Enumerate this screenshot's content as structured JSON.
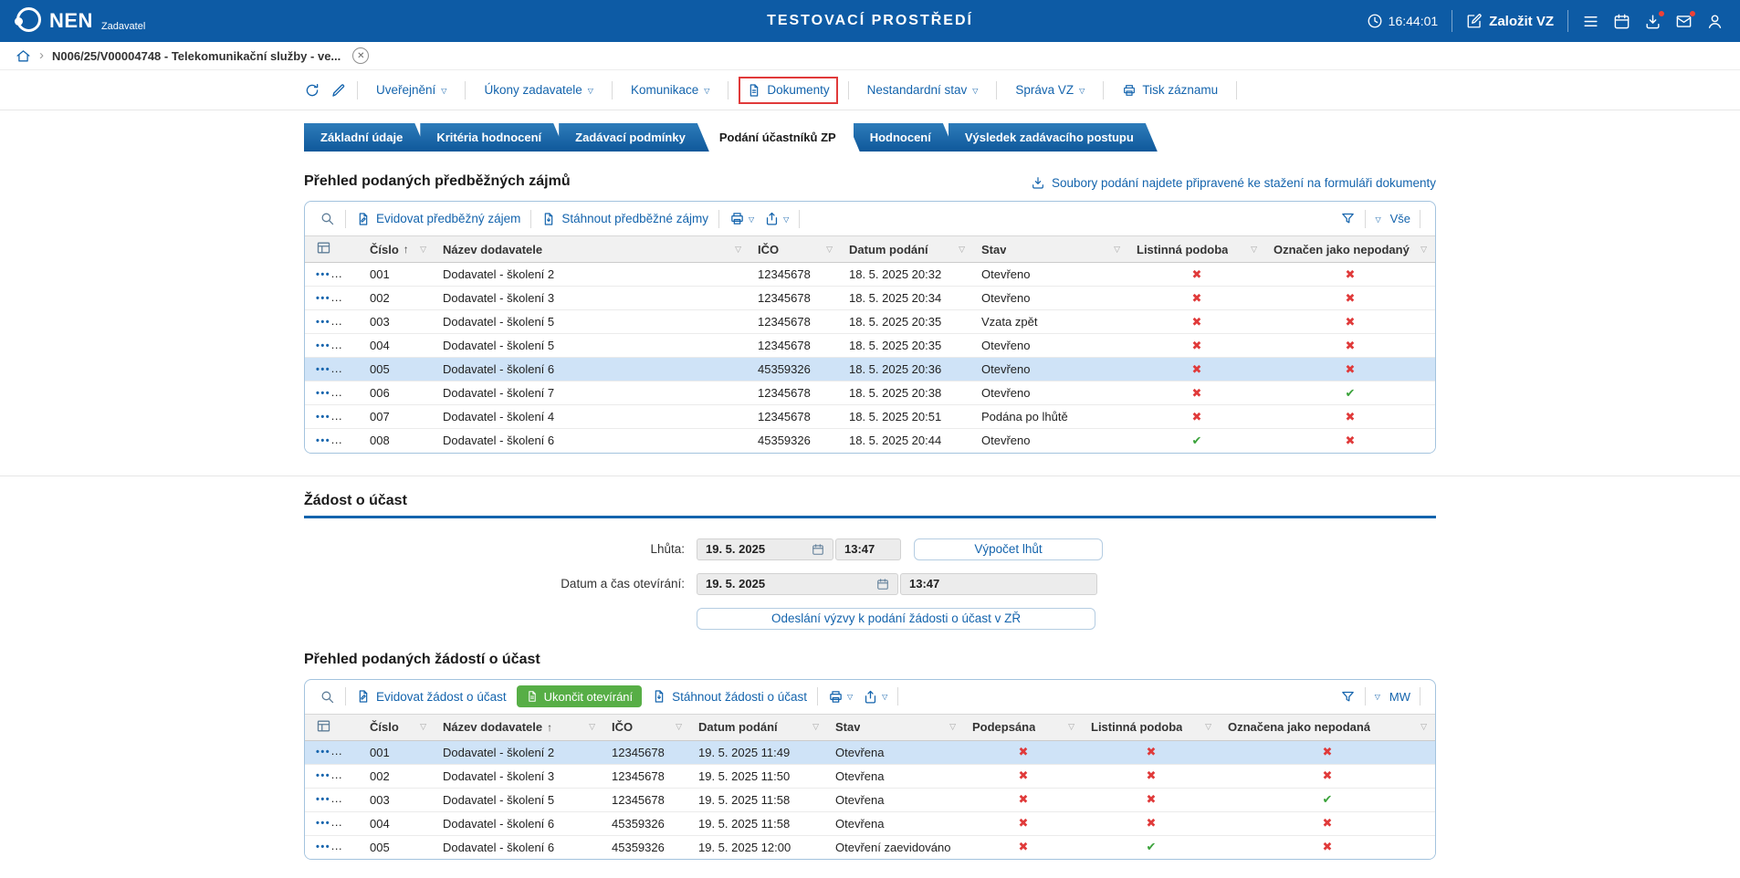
{
  "colors": {
    "topbar_blue": "#0d5ba5",
    "accent_blue": "#1464ad",
    "tab_blue_top": "#2e7cba",
    "tab_blue_bottom": "#0f589b",
    "green_button": "#57ae46",
    "check_green": "#3aa23a",
    "cross_red": "#e03a3a",
    "selected_row": "#cfe3f7",
    "highlight_box_red": "#e03a3a"
  },
  "icons": {
    "dots": "•••",
    "info": "i",
    "check": "✔",
    "cross": "✖",
    "dropdown": "▽",
    "filter": "▽",
    "sort_asc": "↑",
    "chevron": "›",
    "close": "✕"
  },
  "topbar": {
    "brand": "NEN",
    "brand_sub": "Zadavatel",
    "env_title": "TESTOVACÍ PROSTŘEDÍ",
    "clock": "16:44:01",
    "create_vz": "Založit VZ"
  },
  "breadcrumb": {
    "record": "N006/25/V00004748 - Telekomunikační služby - ve..."
  },
  "command_bar": {
    "items": [
      {
        "label": "Uveřejnění",
        "dropdown": true
      },
      {
        "label": "Úkony zadavatele",
        "dropdown": true
      },
      {
        "label": "Komunikace",
        "dropdown": true
      },
      {
        "label": "Dokumenty",
        "icon": "document",
        "highlighted": true
      },
      {
        "label": "Nestandardní stav",
        "dropdown": true
      },
      {
        "label": "Správa VZ",
        "dropdown": true
      },
      {
        "label": "Tisk záznamu",
        "icon": "printer"
      }
    ]
  },
  "tabs": [
    {
      "label": "Základní údaje"
    },
    {
      "label": "Kritéria hodnocení"
    },
    {
      "label": "Zadávací podmínky"
    },
    {
      "label": "Podání účastníků ZP",
      "active": true
    },
    {
      "label": "Hodnocení"
    },
    {
      "label": "Výsledek zadávacího postupu"
    }
  ],
  "section_preliminary": {
    "title": "Přehled podaných předběžných zájmů",
    "files_link": "Soubory podání najdete připravené ke stažení na formuláři dokumenty",
    "toolbar": {
      "evidovat": "Evidovat předběžný zájem",
      "stahnout": "Stáhnout předběžné zájmy",
      "view": "Vše"
    },
    "columns": [
      {
        "label": "Číslo",
        "sort": "asc"
      },
      {
        "label": "Název dodavatele"
      },
      {
        "label": "IČO"
      },
      {
        "label": "Datum podání"
      },
      {
        "label": "Stav"
      },
      {
        "label": "Listinná podoba"
      },
      {
        "label": "Označen jako nepodaný"
      }
    ],
    "rows": [
      {
        "num": "001",
        "name": "Dodavatel - školení 2",
        "ico": "12345678",
        "date": "18. 5. 2025 20:32",
        "status": "Otevřeno",
        "listinna": false,
        "nepodany": false
      },
      {
        "num": "002",
        "name": "Dodavatel - školení 3",
        "ico": "12345678",
        "date": "18. 5. 2025 20:34",
        "status": "Otevřeno",
        "listinna": false,
        "nepodany": false
      },
      {
        "num": "003",
        "name": "Dodavatel - školení 5",
        "ico": "12345678",
        "date": "18. 5. 2025 20:35",
        "status": "Vzata zpět",
        "listinna": false,
        "nepodany": false
      },
      {
        "num": "004",
        "name": "Dodavatel - školení 5",
        "ico": "12345678",
        "date": "18. 5. 2025 20:35",
        "status": "Otevřeno",
        "listinna": false,
        "nepodany": false
      },
      {
        "num": "005",
        "name": "Dodavatel - školení 6",
        "ico": "45359326",
        "date": "18. 5. 2025 20:36",
        "status": "Otevřeno",
        "listinna": false,
        "nepodany": false,
        "selected": true
      },
      {
        "num": "006",
        "name": "Dodavatel - školení 7",
        "ico": "12345678",
        "date": "18. 5. 2025 20:38",
        "status": "Otevřeno",
        "listinna": false,
        "nepodany": true
      },
      {
        "num": "007",
        "name": "Dodavatel - školení 4",
        "ico": "12345678",
        "date": "18. 5. 2025 20:51",
        "status": "Podána po lhůtě",
        "listinna": false,
        "nepodany": false
      },
      {
        "num": "008",
        "name": "Dodavatel - školení 6",
        "ico": "45359326",
        "date": "18. 5. 2025 20:44",
        "status": "Otevřeno",
        "listinna": true,
        "nepodany": false
      }
    ]
  },
  "section_zadost": {
    "title": "Žádost o účast",
    "lhuta_label": "Lhůta:",
    "lhuta_date": "19. 5. 2025",
    "lhuta_time": "13:47",
    "vypocet_button": "Výpočet lhůt",
    "opening_label": "Datum a čas otevírání:",
    "opening_date": "19. 5. 2025",
    "opening_time": "13:47",
    "odeslani_button": "Odeslání výzvy k podání žádosti o účast v ZŘ"
  },
  "section_zadosti_prehled": {
    "title": "Přehled podaných žádostí o účast",
    "toolbar": {
      "evidovat": "Evidovat žádost o účast",
      "ukoncit": "Ukončit otevírání",
      "stahnout": "Stáhnout žádosti o účast",
      "view": "MW"
    },
    "columns": [
      {
        "label": "Číslo"
      },
      {
        "label": "Název dodavatele",
        "sort": "asc"
      },
      {
        "label": "IČO"
      },
      {
        "label": "Datum podání"
      },
      {
        "label": "Stav"
      },
      {
        "label": "Podepsána"
      },
      {
        "label": "Listinná podoba"
      },
      {
        "label": "Označena jako nepodaná"
      }
    ],
    "rows": [
      {
        "num": "001",
        "name": "Dodavatel - školení 2",
        "ico": "12345678",
        "date": "19. 5. 2025 11:49",
        "status": "Otevřena",
        "podepsana": false,
        "listinna": false,
        "nepodana": false,
        "selected": true
      },
      {
        "num": "002",
        "name": "Dodavatel - školení 3",
        "ico": "12345678",
        "date": "19. 5. 2025 11:50",
        "status": "Otevřena",
        "podepsana": false,
        "listinna": false,
        "nepodana": false
      },
      {
        "num": "003",
        "name": "Dodavatel - školení 5",
        "ico": "12345678",
        "date": "19. 5. 2025 11:58",
        "status": "Otevřena",
        "podepsana": false,
        "listinna": false,
        "nepodana": true
      },
      {
        "num": "004",
        "name": "Dodavatel - školení 6",
        "ico": "45359326",
        "date": "19. 5. 2025 11:58",
        "status": "Otevřena",
        "podepsana": false,
        "listinna": false,
        "nepodana": false
      },
      {
        "num": "005",
        "name": "Dodavatel - školení 6",
        "ico": "45359326",
        "date": "19. 5. 2025 12:00",
        "status": "Otevření zaevidováno",
        "podepsana": false,
        "listinna": true,
        "nepodana": false
      }
    ]
  }
}
